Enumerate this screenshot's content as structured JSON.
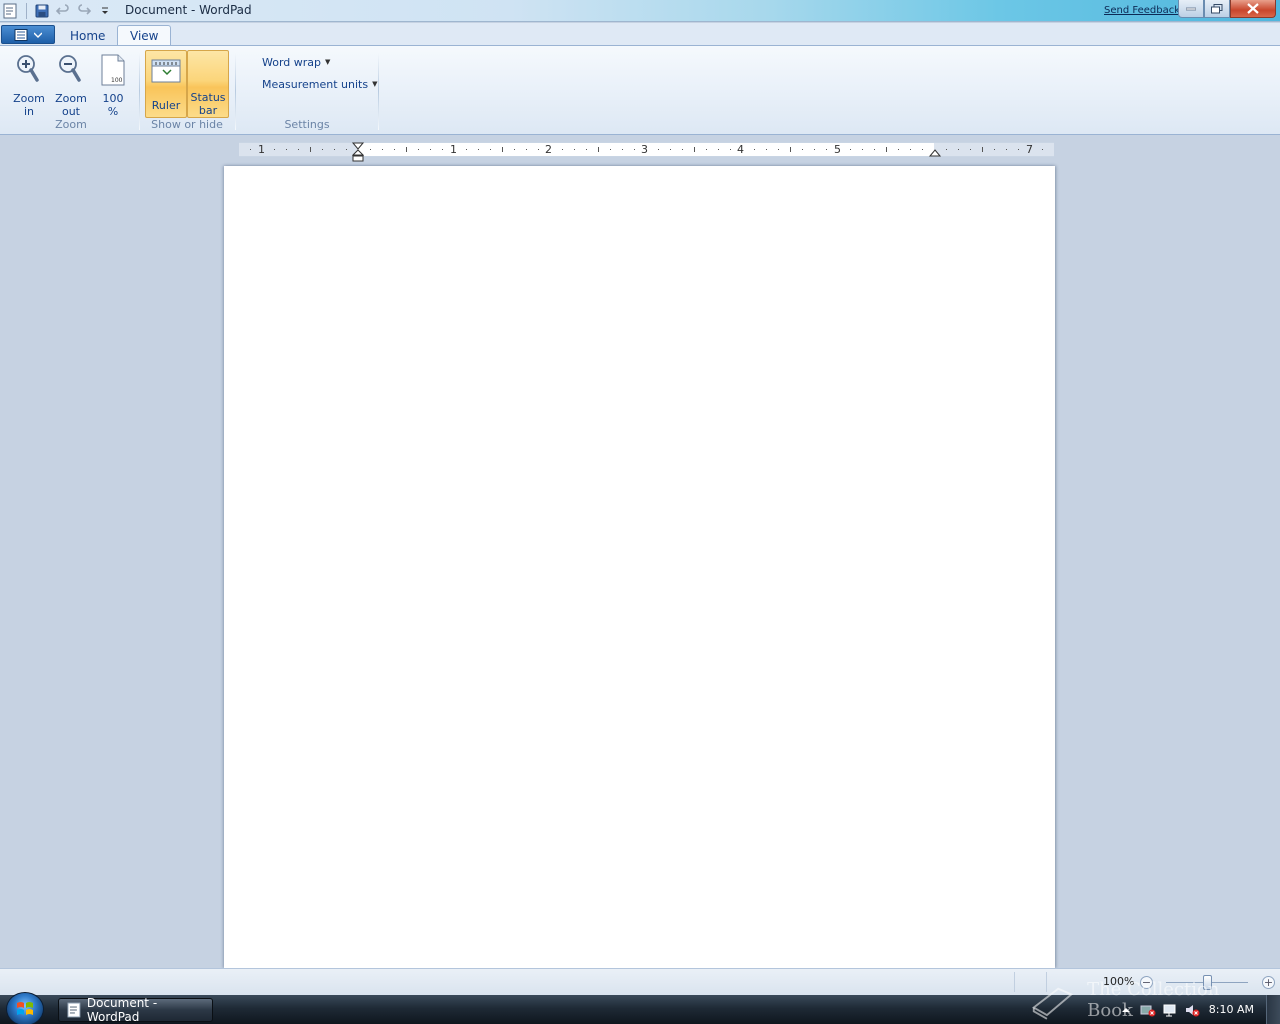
{
  "window": {
    "title": "Document - WordPad",
    "send_feedback": "Send Feedback"
  },
  "ribbon": {
    "tabs": [
      {
        "label": "Home"
      },
      {
        "label": "View"
      }
    ],
    "groups": {
      "zoom": {
        "label": "Zoom",
        "zoom_in": "Zoom in",
        "zoom_in_l1": "Zoom",
        "zoom_in_l2": "in",
        "zoom_out_l1": "Zoom",
        "zoom_out_l2": "out",
        "pct_l1": "100",
        "pct_l2": "%",
        "pct_icon_text": "100"
      },
      "show_hide": {
        "label": "Show or hide",
        "ruler": "Ruler",
        "status_l1": "Status",
        "status_l2": "bar"
      },
      "settings": {
        "label": "Settings",
        "word_wrap": "Word wrap",
        "measurement_units": "Measurement units"
      }
    }
  },
  "ruler": {
    "labels": [
      "1",
      "1",
      "2",
      "3",
      "4",
      "5",
      "7"
    ]
  },
  "statusbar": {
    "zoom_level": "100%",
    "zoom_minus": "−",
    "zoom_plus": "+"
  },
  "taskbar": {
    "task_label": "Document - WordPad",
    "clock": "8:10 AM"
  },
  "watermark": "The Collection Book",
  "colors": {
    "ribbon_active": "#fbd57a",
    "accent": "#15428b"
  }
}
